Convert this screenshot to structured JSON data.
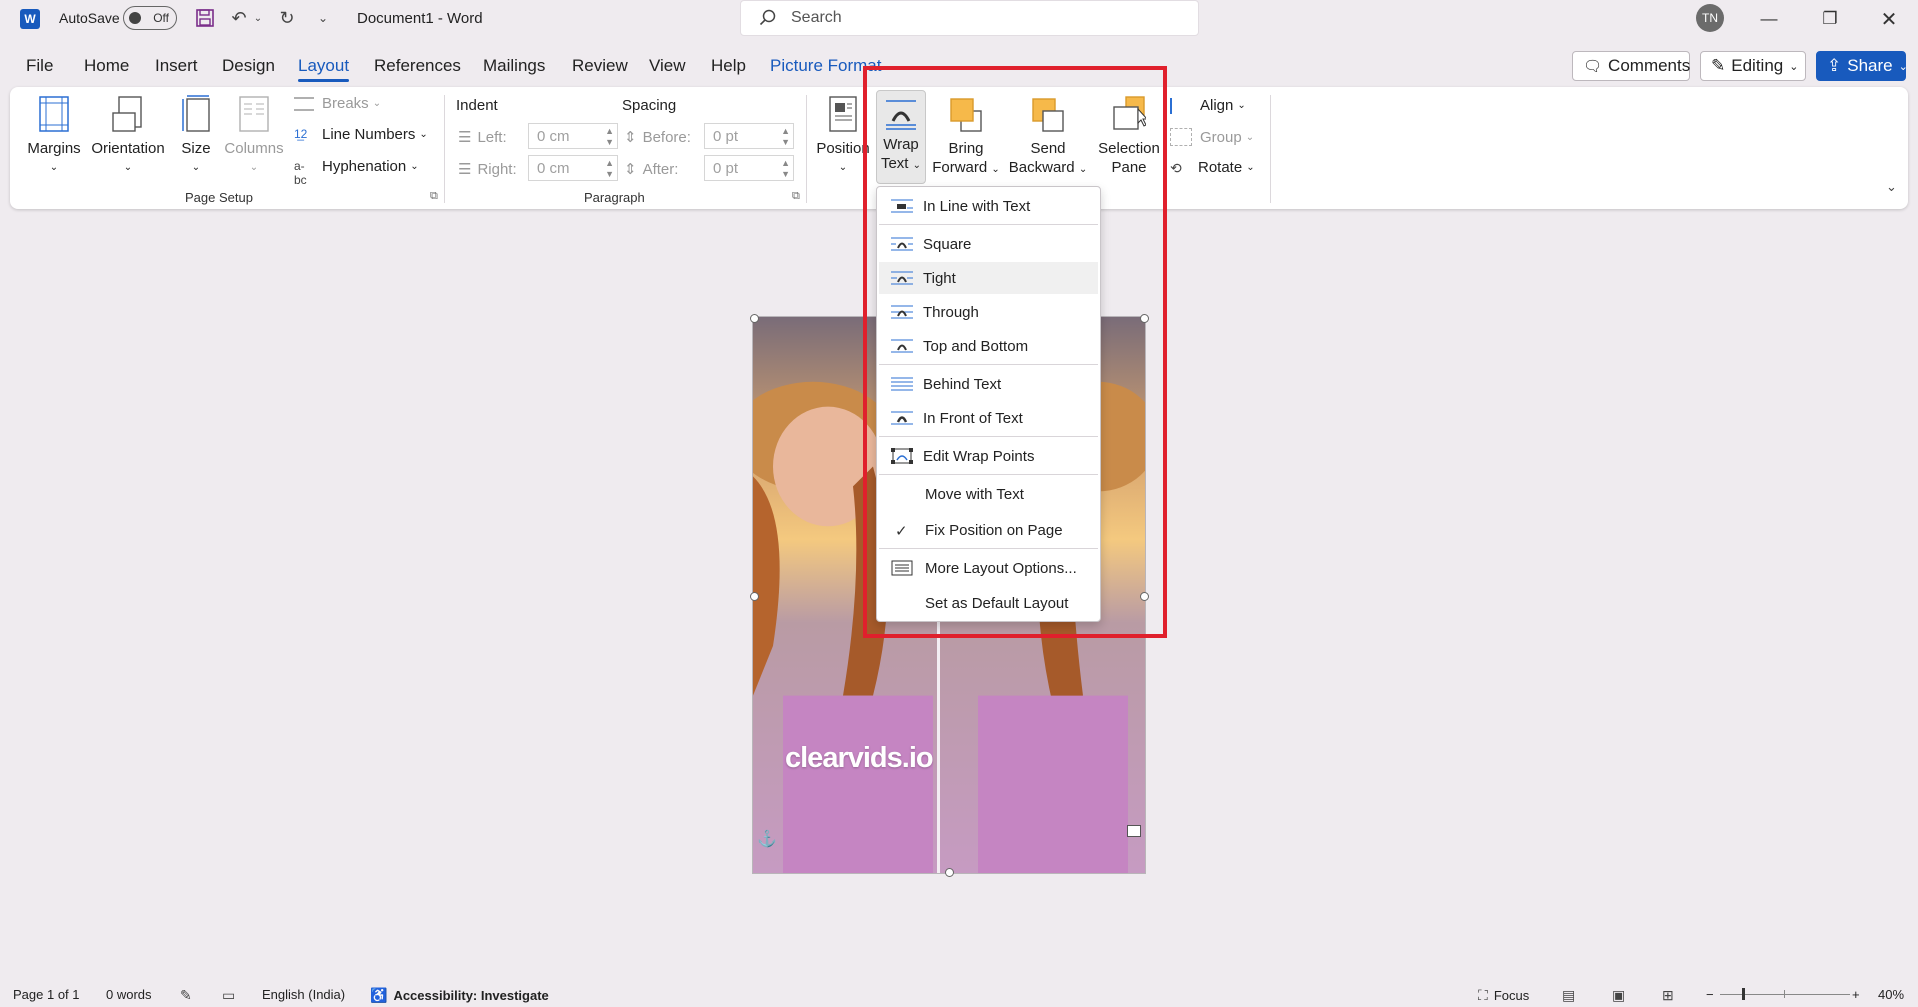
{
  "titlebar": {
    "autosave_label": "AutoSave",
    "autosave_state": "Off",
    "document_title": "Document1  -  Word",
    "search_placeholder": "Search",
    "avatar_initials": "TN"
  },
  "tabs": [
    "File",
    "Home",
    "Insert",
    "Design",
    "Layout",
    "References",
    "Mailings",
    "Review",
    "View",
    "Help",
    "Picture Format"
  ],
  "active_tab": "Layout",
  "header_buttons": {
    "comments": "Comments",
    "editing": "Editing",
    "share": "Share"
  },
  "ribbon": {
    "page_setup": {
      "margins": "Margins",
      "orientation": "Orientation",
      "size": "Size",
      "columns": "Columns",
      "breaks": "Breaks",
      "line_numbers": "Line Numbers",
      "hyphenation": "Hyphenation",
      "group_label": "Page Setup"
    },
    "paragraph": {
      "indent_label": "Indent",
      "spacing_label": "Spacing",
      "left_label": "Left:",
      "right_label": "Right:",
      "before_label": "Before:",
      "after_label": "After:",
      "left_value": "0 cm",
      "right_value": "0 cm",
      "before_value": "0 pt",
      "after_value": "0 pt",
      "group_label": "Paragraph"
    },
    "arrange": {
      "position": "Position",
      "wrap_text_1": "Wrap",
      "wrap_text_2": "Text",
      "bring_forward_1": "Bring",
      "bring_forward_2": "Forward",
      "send_backward_1": "Send",
      "send_backward_2": "Backward",
      "selection_pane_1": "Selection",
      "selection_pane_2": "Pane",
      "align": "Align",
      "group": "Group",
      "rotate": "Rotate"
    }
  },
  "wrap_menu": {
    "items": [
      "In Line with Text",
      "Square",
      "Tight",
      "Through",
      "Top and Bottom",
      "Behind Text",
      "In Front of Text",
      "Edit Wrap Points",
      "Move with Text",
      "Fix Position on Page",
      "More Layout Options...",
      "Set as Default Layout"
    ],
    "hovered": "Tight",
    "checked": "Fix Position on Page"
  },
  "picture": {
    "watermark": "clearvids.io"
  },
  "status": {
    "page": "Page 1 of 1",
    "words": "0 words",
    "language": "English (India)",
    "accessibility": "Accessibility: Investigate",
    "focus": "Focus",
    "zoom": "40%"
  },
  "colors": {
    "accent": "#185abd",
    "highlight_box": "#e0202c",
    "picture_format_tab": "#185abd"
  }
}
